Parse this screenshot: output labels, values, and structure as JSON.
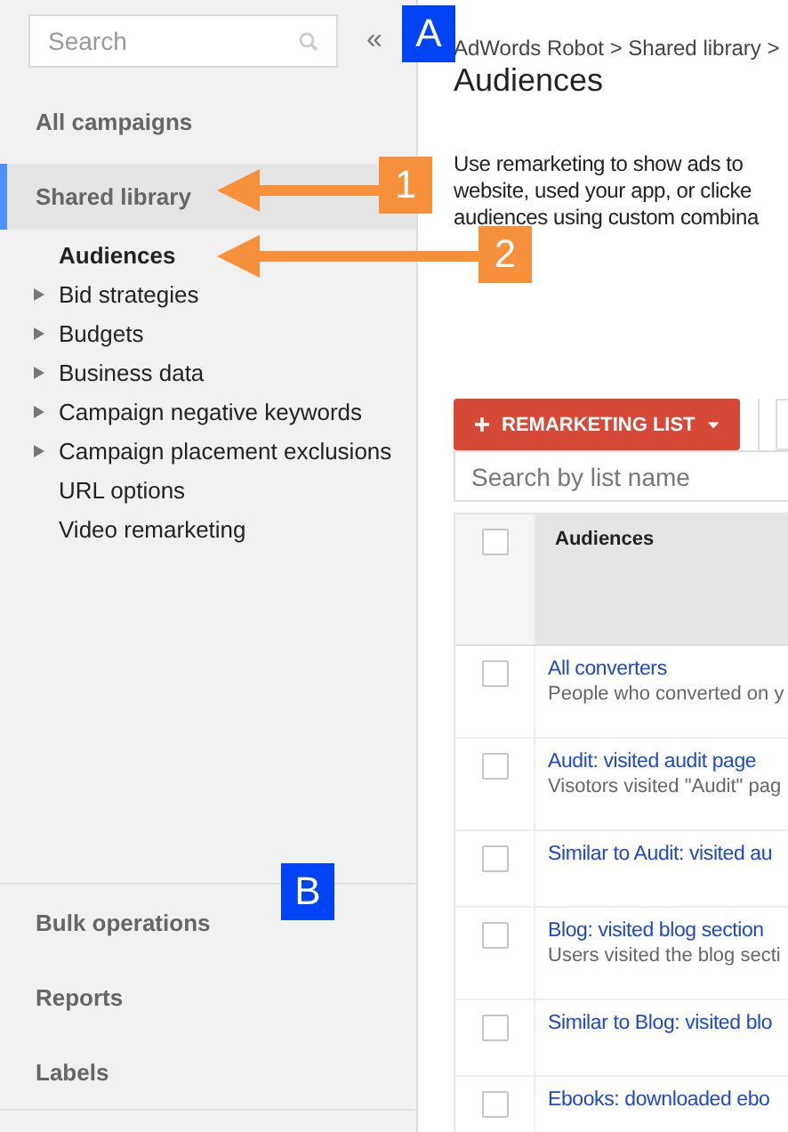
{
  "sidebar": {
    "search": {
      "placeholder": "Search"
    },
    "collapse": "«",
    "top_item": {
      "label": "All campaigns"
    },
    "section": {
      "label": "Shared library",
      "selected": true
    },
    "items": [
      {
        "label": "Audiences",
        "selected": true,
        "expandable": false
      },
      {
        "label": "Bid strategies",
        "selected": false,
        "expandable": true
      },
      {
        "label": "Budgets",
        "selected": false,
        "expandable": true
      },
      {
        "label": "Business data",
        "selected": false,
        "expandable": true
      },
      {
        "label": "Campaign negative keywords",
        "selected": false,
        "expandable": true
      },
      {
        "label": "Campaign placement exclusions",
        "selected": false,
        "expandable": true
      },
      {
        "label": "URL options",
        "selected": false,
        "expandable": false
      },
      {
        "label": "Video remarketing",
        "selected": false,
        "expandable": false
      }
    ],
    "bottom_items": [
      {
        "label": "Bulk operations"
      },
      {
        "label": "Reports"
      },
      {
        "label": "Labels"
      }
    ]
  },
  "breadcrumb": "AdWords Robot > Shared library >",
  "title": "Audiences",
  "intro_lines": [
    "Use remarketing to show ads to",
    "website, used your app, or clicke",
    "audiences using custom combina"
  ],
  "toolbar": {
    "button": "REMARKETING LIST",
    "search": {
      "placeholder": "Search by list name"
    }
  },
  "table": {
    "columns": [
      "Audiences"
    ],
    "select_all": {
      "checked": false
    },
    "rows": [
      {
        "name": "All converters",
        "description": "People who converted on y",
        "checked": false
      },
      {
        "name": "Audit: visited audit page",
        "description": "Visotors visited \"Audit\" pag",
        "checked": false
      },
      {
        "name": "Similar to Audit: visited au",
        "checked": false
      },
      {
        "name": "Blog: visited blog section",
        "description": "Users visited the blog secti",
        "checked": false
      },
      {
        "name": "Similar to Blog: visited blo",
        "checked": false
      },
      {
        "name": "Ebooks: downloaded ebo",
        "checked": false
      }
    ]
  },
  "annotations": [
    {
      "label": "A",
      "kind": "box"
    },
    {
      "label": "1",
      "kind": "arrow"
    },
    {
      "label": "2",
      "kind": "arrow"
    },
    {
      "label": "B",
      "kind": "box"
    }
  ]
}
